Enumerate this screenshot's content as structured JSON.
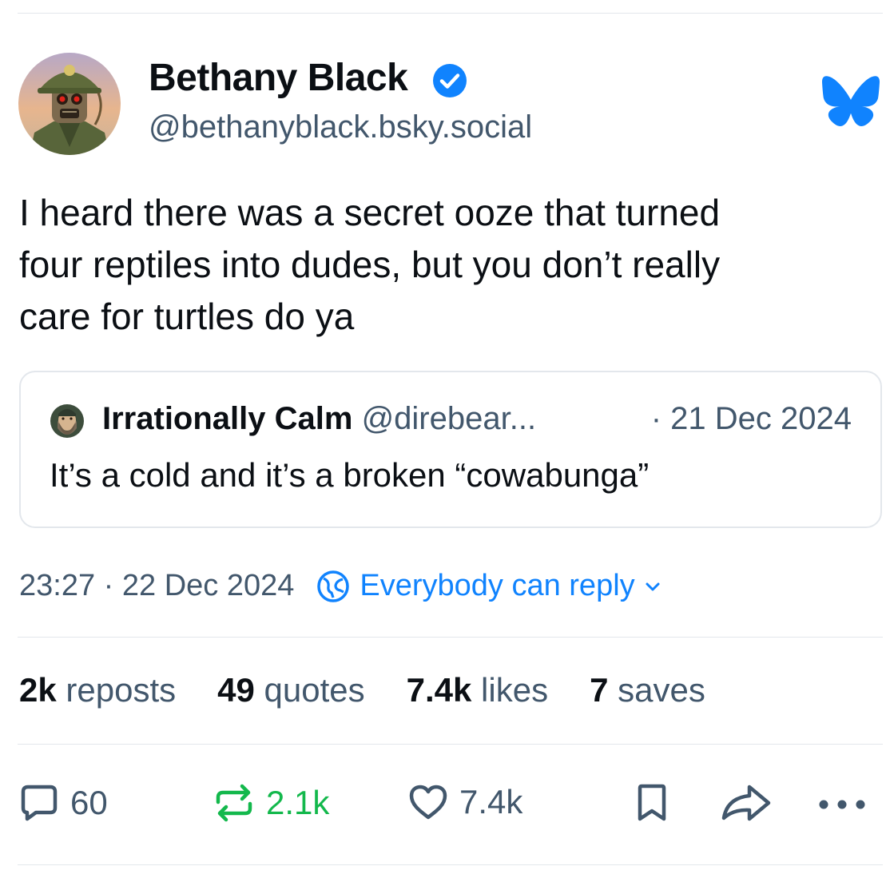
{
  "post": {
    "author": {
      "name": "Bethany Black",
      "handle": "@bethanyblack.bsky.social",
      "verified": true,
      "avatar_icon": "soldier-robot-avatar"
    },
    "text": "I heard there was a secret ooze that turned\nfour reptiles into dudes, but you don’t really\ncare for turtles do ya",
    "quoted_post": {
      "author_name": "Irrationally Calm",
      "author_handle": "@direbear...",
      "date": "· 21 Dec 2024",
      "text": "It’s a cold and it’s a broken “cowabunga”",
      "avatar_icon": "bearded-man-avatar"
    },
    "timestamp": "23:27 · 22 Dec 2024",
    "reply_setting": "Everybody can reply"
  },
  "stats": {
    "reposts_count": "2k",
    "reposts_label": "reposts",
    "quotes_count": "49",
    "quotes_label": "quotes",
    "likes_count": "7.4k",
    "likes_label": "likes",
    "saves_count": "7",
    "saves_label": "saves"
  },
  "actions": {
    "replies": "60",
    "reposts": "2.1k",
    "likes": "7.4k",
    "icons": [
      "reply-icon",
      "repost-icon",
      "heart-icon",
      "bookmark-icon",
      "share-icon",
      "more-icon"
    ]
  },
  "colors": {
    "accent_blue": "#1083fe",
    "repost_green": "#13b84c",
    "secondary_text": "#42576c",
    "primary_text": "#0b0f14",
    "divider": "#e3e7ec"
  }
}
